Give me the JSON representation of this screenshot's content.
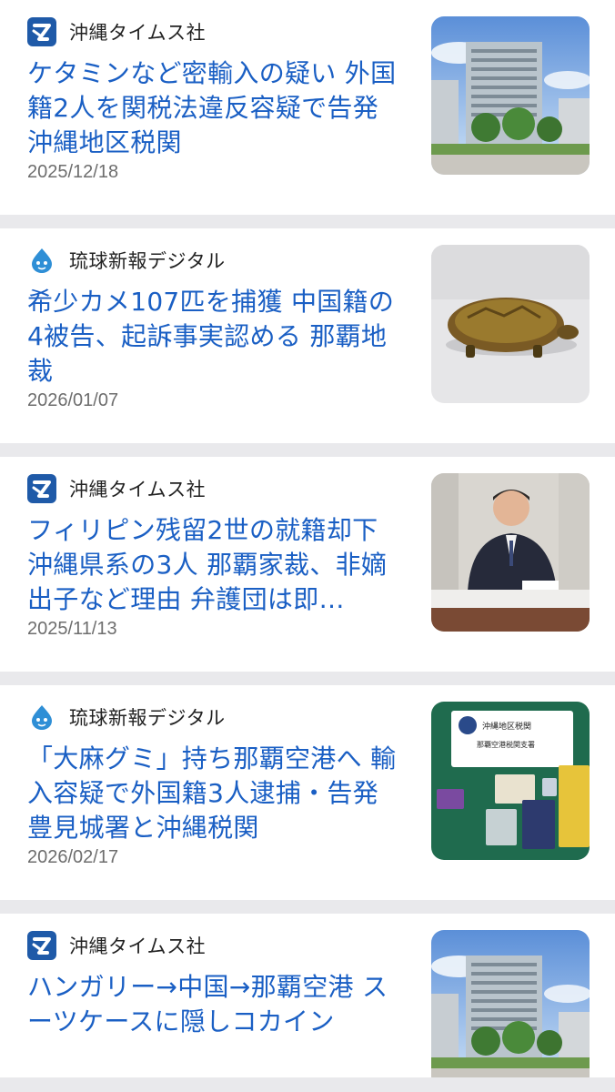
{
  "articles": [
    {
      "source": "沖縄タイムス社",
      "source_logo": "okinawa-times-logo",
      "title": "ケタミンなど密輸入の疑い 外国籍2人を関税法違反容疑で告発 沖縄地区税関",
      "date": "2025/12/18",
      "thumbnail": "government-building-photo"
    },
    {
      "source": "琉球新報デジタル",
      "source_logo": "ryukyu-shimpo-logo",
      "title": "希少カメ107匹を捕獲 中国籍の4被告、起訴事実認める 那覇地裁",
      "date": "2026/01/07",
      "thumbnail": "turtle-photo"
    },
    {
      "source": "沖縄タイムス社",
      "source_logo": "okinawa-times-logo",
      "title": "フィリピン残留2世の就籍却下 沖縄県系の3人 那覇家裁、非嫡出子など理由 弁護団は即…",
      "date": "2025/11/13",
      "thumbnail": "press-conference-photo"
    },
    {
      "source": "琉球新報デジタル",
      "source_logo": "ryukyu-shimpo-logo",
      "title": "「大麻グミ」持ち那覇空港へ 輸入容疑で外国籍3人逮捕・告発 豊見城署と沖縄税関",
      "date": "2026/02/17",
      "thumbnail": "seized-items-photo"
    },
    {
      "source": "沖縄タイムス社",
      "source_logo": "okinawa-times-logo",
      "title": "ハンガリー→中国→那覇空港 スーツケースに隠しコカイン",
      "date": "",
      "thumbnail": "government-building-photo"
    }
  ],
  "thumb_texts": {
    "sign_line1": "沖縄地区税関",
    "sign_line2": "那覇空港税関支署"
  },
  "colors": {
    "title_link": "#1a5fc4",
    "times_logo_bg": "#1f5aa8",
    "separator": "#e9e9ec"
  }
}
